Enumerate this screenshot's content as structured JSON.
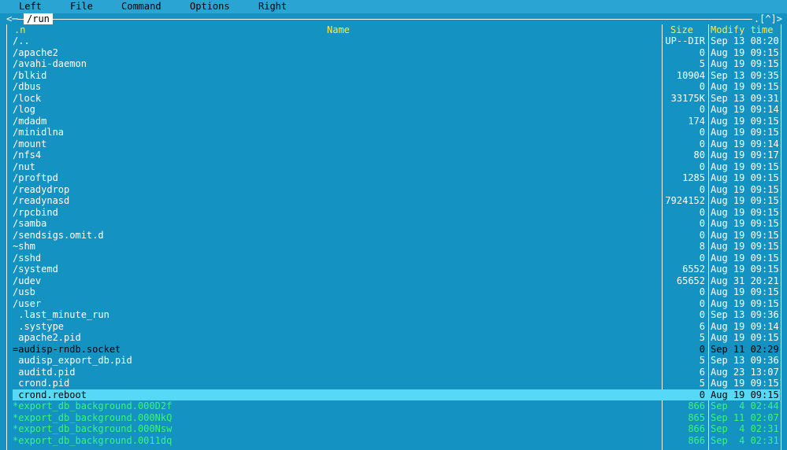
{
  "menu": [
    "Left",
    "File",
    "Command",
    "Options",
    "Right"
  ],
  "panel": {
    "border_left": "<─",
    "path": "/run",
    "border_right": ".[^]>"
  },
  "columns": {
    "name_sort": ".n",
    "name": "Name",
    "size": "Size",
    "time": "Modify time"
  },
  "files": [
    {
      "name": "/..",
      "size": "UP--DIR",
      "time": "Sep 13 08:20",
      "type": "dir"
    },
    {
      "name": "/apache2",
      "size": "0",
      "time": "Aug 19 09:15",
      "type": "dir"
    },
    {
      "name": "/avahi-daemon",
      "size": "5",
      "time": "Aug 19 09:15",
      "type": "dir"
    },
    {
      "name": "/blkid",
      "size": "10904",
      "time": "Sep 13 09:35",
      "type": "dir"
    },
    {
      "name": "/dbus",
      "size": "0",
      "time": "Aug 19 09:15",
      "type": "dir"
    },
    {
      "name": "/lock",
      "size": "33175K",
      "time": "Sep 13 09:31",
      "type": "dir"
    },
    {
      "name": "/log",
      "size": "0",
      "time": "Aug 19 09:14",
      "type": "dir"
    },
    {
      "name": "/mdadm",
      "size": "174",
      "time": "Aug 19 09:15",
      "type": "dir"
    },
    {
      "name": "/minidlna",
      "size": "0",
      "time": "Aug 19 09:15",
      "type": "dir"
    },
    {
      "name": "/mount",
      "size": "0",
      "time": "Aug 19 09:14",
      "type": "dir"
    },
    {
      "name": "/nfs4",
      "size": "80",
      "time": "Aug 19 09:17",
      "type": "dir"
    },
    {
      "name": "/nut",
      "size": "0",
      "time": "Aug 19 09:15",
      "type": "dir"
    },
    {
      "name": "/proftpd",
      "size": "1285",
      "time": "Aug 19 09:15",
      "type": "dir"
    },
    {
      "name": "/readydrop",
      "size": "0",
      "time": "Aug 19 09:15",
      "type": "dir"
    },
    {
      "name": "/readynasd",
      "size": "7924152",
      "time": "Aug 19 09:15",
      "type": "dir"
    },
    {
      "name": "/rpcbind",
      "size": "0",
      "time": "Aug 19 09:15",
      "type": "dir"
    },
    {
      "name": "/samba",
      "size": "0",
      "time": "Aug 19 09:15",
      "type": "dir"
    },
    {
      "name": "/sendsigs.omit.d",
      "size": "0",
      "time": "Aug 19 09:15",
      "type": "dir"
    },
    {
      "name": "~shm",
      "size": "8",
      "time": "Aug 19 09:15",
      "type": "dir"
    },
    {
      "name": "/sshd",
      "size": "0",
      "time": "Aug 19 09:15",
      "type": "dir"
    },
    {
      "name": "/systemd",
      "size": "6552",
      "time": "Aug 19 09:15",
      "type": "dir"
    },
    {
      "name": "/udev",
      "size": "65652",
      "time": "Aug 31 20:21",
      "type": "dir"
    },
    {
      "name": "/usb",
      "size": "0",
      "time": "Aug 19 09:15",
      "type": "dir"
    },
    {
      "name": "/user",
      "size": "0",
      "time": "Aug 19 09:15",
      "type": "dir"
    },
    {
      "name": " .last_minute_run",
      "size": "0",
      "time": "Sep 13 09:36",
      "type": "file"
    },
    {
      "name": " .systype",
      "size": "6",
      "time": "Aug 19 09:14",
      "type": "file"
    },
    {
      "name": " apache2.pid",
      "size": "5",
      "time": "Aug 19 09:15",
      "type": "file"
    },
    {
      "name": "=audisp-rndb.socket",
      "size": "0",
      "time": "Sep 11 02:29",
      "type": "socket"
    },
    {
      "name": " audisp_export_db.pid",
      "size": "5",
      "time": "Sep 13 09:36",
      "type": "file"
    },
    {
      "name": " auditd.pid",
      "size": "6",
      "time": "Aug 23 13:07",
      "type": "file"
    },
    {
      "name": " crond.pid",
      "size": "5",
      "time": "Aug 19 09:15",
      "type": "file"
    },
    {
      "name": " crond.reboot",
      "size": "0",
      "time": "Aug 19 09:15",
      "type": "selected"
    },
    {
      "name": "*export_db_background.000D2f",
      "size": "866",
      "time": "Sep  4 02:44",
      "type": "exec"
    },
    {
      "name": "*export_db_background.000NkQ",
      "size": "865",
      "time": "Sep 11 02:07",
      "type": "exec"
    },
    {
      "name": "*export_db_background.000Nsw",
      "size": "866",
      "time": "Sep  4 02:31",
      "type": "exec"
    },
    {
      "name": "*export_db_background.0011dq",
      "size": "866",
      "time": "Sep  4 02:31",
      "type": "exec"
    }
  ]
}
